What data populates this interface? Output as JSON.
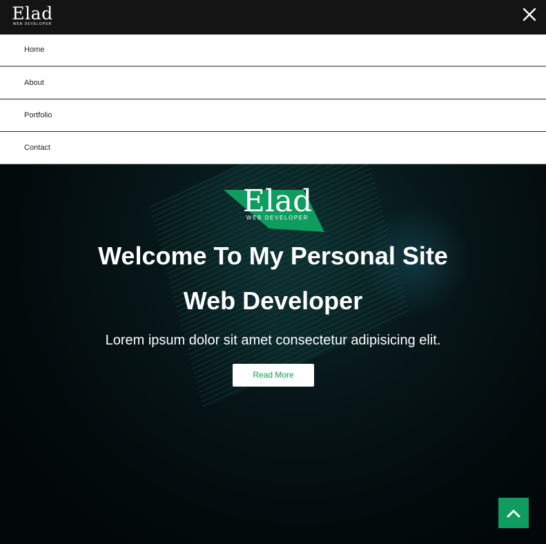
{
  "header": {
    "brand_name": "Elad",
    "brand_sub": "WEB DEVELOPER",
    "close_icon": "close-icon"
  },
  "menu": {
    "items": [
      {
        "label": "Home"
      },
      {
        "label": "About"
      },
      {
        "label": "Portfolio"
      },
      {
        "label": "Contact"
      }
    ]
  },
  "hero": {
    "logo_name": "Elad",
    "logo_sub": "WEB DEVELOPER",
    "title": "Welcome To My Personal Site",
    "subtitle": "Web Developer",
    "text": "Lorem ipsum dolor sit amet consectetur adipisicing elit.",
    "button_label": "Read More"
  },
  "scroll_top": {
    "icon": "chevron-up-icon"
  },
  "colors": {
    "accent": "#0f9d5f",
    "header_bg": "#141414",
    "hero_bg": "#020a0b"
  }
}
